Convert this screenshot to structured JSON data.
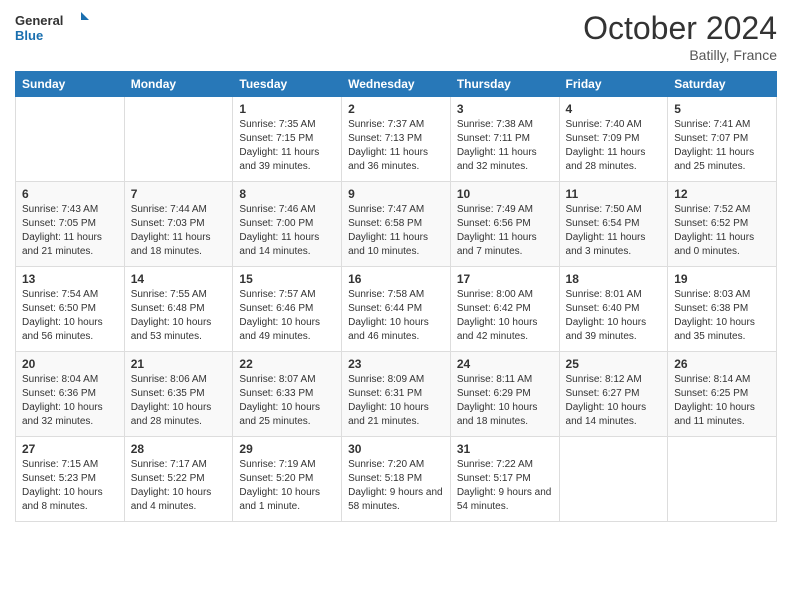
{
  "header": {
    "logo_line1": "General",
    "logo_line2": "Blue",
    "month": "October 2024",
    "location": "Batilly, France"
  },
  "days_of_week": [
    "Sunday",
    "Monday",
    "Tuesday",
    "Wednesday",
    "Thursday",
    "Friday",
    "Saturday"
  ],
  "weeks": [
    [
      {
        "day": "",
        "info": ""
      },
      {
        "day": "",
        "info": ""
      },
      {
        "day": "1",
        "info": "Sunrise: 7:35 AM\nSunset: 7:15 PM\nDaylight: 11 hours and 39 minutes."
      },
      {
        "day": "2",
        "info": "Sunrise: 7:37 AM\nSunset: 7:13 PM\nDaylight: 11 hours and 36 minutes."
      },
      {
        "day": "3",
        "info": "Sunrise: 7:38 AM\nSunset: 7:11 PM\nDaylight: 11 hours and 32 minutes."
      },
      {
        "day": "4",
        "info": "Sunrise: 7:40 AM\nSunset: 7:09 PM\nDaylight: 11 hours and 28 minutes."
      },
      {
        "day": "5",
        "info": "Sunrise: 7:41 AM\nSunset: 7:07 PM\nDaylight: 11 hours and 25 minutes."
      }
    ],
    [
      {
        "day": "6",
        "info": "Sunrise: 7:43 AM\nSunset: 7:05 PM\nDaylight: 11 hours and 21 minutes."
      },
      {
        "day": "7",
        "info": "Sunrise: 7:44 AM\nSunset: 7:03 PM\nDaylight: 11 hours and 18 minutes."
      },
      {
        "day": "8",
        "info": "Sunrise: 7:46 AM\nSunset: 7:00 PM\nDaylight: 11 hours and 14 minutes."
      },
      {
        "day": "9",
        "info": "Sunrise: 7:47 AM\nSunset: 6:58 PM\nDaylight: 11 hours and 10 minutes."
      },
      {
        "day": "10",
        "info": "Sunrise: 7:49 AM\nSunset: 6:56 PM\nDaylight: 11 hours and 7 minutes."
      },
      {
        "day": "11",
        "info": "Sunrise: 7:50 AM\nSunset: 6:54 PM\nDaylight: 11 hours and 3 minutes."
      },
      {
        "day": "12",
        "info": "Sunrise: 7:52 AM\nSunset: 6:52 PM\nDaylight: 11 hours and 0 minutes."
      }
    ],
    [
      {
        "day": "13",
        "info": "Sunrise: 7:54 AM\nSunset: 6:50 PM\nDaylight: 10 hours and 56 minutes."
      },
      {
        "day": "14",
        "info": "Sunrise: 7:55 AM\nSunset: 6:48 PM\nDaylight: 10 hours and 53 minutes."
      },
      {
        "day": "15",
        "info": "Sunrise: 7:57 AM\nSunset: 6:46 PM\nDaylight: 10 hours and 49 minutes."
      },
      {
        "day": "16",
        "info": "Sunrise: 7:58 AM\nSunset: 6:44 PM\nDaylight: 10 hours and 46 minutes."
      },
      {
        "day": "17",
        "info": "Sunrise: 8:00 AM\nSunset: 6:42 PM\nDaylight: 10 hours and 42 minutes."
      },
      {
        "day": "18",
        "info": "Sunrise: 8:01 AM\nSunset: 6:40 PM\nDaylight: 10 hours and 39 minutes."
      },
      {
        "day": "19",
        "info": "Sunrise: 8:03 AM\nSunset: 6:38 PM\nDaylight: 10 hours and 35 minutes."
      }
    ],
    [
      {
        "day": "20",
        "info": "Sunrise: 8:04 AM\nSunset: 6:36 PM\nDaylight: 10 hours and 32 minutes."
      },
      {
        "day": "21",
        "info": "Sunrise: 8:06 AM\nSunset: 6:35 PM\nDaylight: 10 hours and 28 minutes."
      },
      {
        "day": "22",
        "info": "Sunrise: 8:07 AM\nSunset: 6:33 PM\nDaylight: 10 hours and 25 minutes."
      },
      {
        "day": "23",
        "info": "Sunrise: 8:09 AM\nSunset: 6:31 PM\nDaylight: 10 hours and 21 minutes."
      },
      {
        "day": "24",
        "info": "Sunrise: 8:11 AM\nSunset: 6:29 PM\nDaylight: 10 hours and 18 minutes."
      },
      {
        "day": "25",
        "info": "Sunrise: 8:12 AM\nSunset: 6:27 PM\nDaylight: 10 hours and 14 minutes."
      },
      {
        "day": "26",
        "info": "Sunrise: 8:14 AM\nSunset: 6:25 PM\nDaylight: 10 hours and 11 minutes."
      }
    ],
    [
      {
        "day": "27",
        "info": "Sunrise: 7:15 AM\nSunset: 5:23 PM\nDaylight: 10 hours and 8 minutes."
      },
      {
        "day": "28",
        "info": "Sunrise: 7:17 AM\nSunset: 5:22 PM\nDaylight: 10 hours and 4 minutes."
      },
      {
        "day": "29",
        "info": "Sunrise: 7:19 AM\nSunset: 5:20 PM\nDaylight: 10 hours and 1 minute."
      },
      {
        "day": "30",
        "info": "Sunrise: 7:20 AM\nSunset: 5:18 PM\nDaylight: 9 hours and 58 minutes."
      },
      {
        "day": "31",
        "info": "Sunrise: 7:22 AM\nSunset: 5:17 PM\nDaylight: 9 hours and 54 minutes."
      },
      {
        "day": "",
        "info": ""
      },
      {
        "day": "",
        "info": ""
      }
    ]
  ]
}
